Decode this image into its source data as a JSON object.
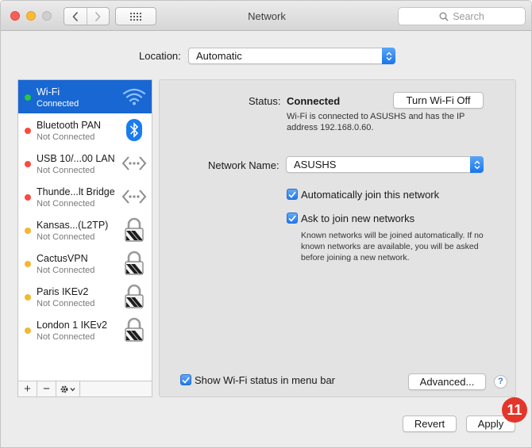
{
  "window": {
    "title": "Network"
  },
  "search": {
    "placeholder": "Search"
  },
  "location": {
    "label": "Location:",
    "value": "Automatic"
  },
  "services": [
    {
      "name": "Wi-Fi",
      "status": "Connected",
      "dot": "green",
      "icon": "wifi-icon",
      "selected": true
    },
    {
      "name": "Bluetooth PAN",
      "status": "Not Connected",
      "dot": "red",
      "icon": "bluetooth-icon"
    },
    {
      "name": "USB 10/...00 LAN",
      "status": "Not Connected",
      "dot": "red",
      "icon": "ethernet-icon"
    },
    {
      "name": "Thunde...lt Bridge",
      "status": "Not Connected",
      "dot": "red",
      "icon": "ethernet-icon"
    },
    {
      "name": "Kansas...(L2TP)",
      "status": "Not Connected",
      "dot": "yellow",
      "icon": "lock-icon"
    },
    {
      "name": "CactusVPN",
      "status": "Not Connected",
      "dot": "yellow",
      "icon": "lock-icon"
    },
    {
      "name": "Paris IKEv2",
      "status": "Not Connected",
      "dot": "yellow",
      "icon": "lock-icon"
    },
    {
      "name": "London 1 IKEv2",
      "status": "Not Connected",
      "dot": "yellow",
      "icon": "lock-icon"
    }
  ],
  "sidebar_footer": {
    "add": "+",
    "remove": "−"
  },
  "detail": {
    "status_label": "Status:",
    "status_value": "Connected",
    "turn_off_button": "Turn Wi-Fi Off",
    "status_description": "Wi-Fi is connected to ASUSHS and has the IP address 192.168.0.60.",
    "network_name_label": "Network Name:",
    "network_name_value": "ASUSHS",
    "auto_join_label": "Automatically join this network",
    "ask_join_label": "Ask to join new networks",
    "ask_join_description": "Known networks will be joined automatically. If no known networks are available, you will be asked before joining a new network.",
    "show_status_label": "Show Wi-Fi status in menu bar",
    "advanced_button": "Advanced...",
    "help_button": "?"
  },
  "footer": {
    "revert_button": "Revert",
    "apply_button": "Apply",
    "badge": "11"
  },
  "colors": {
    "selection": "#1967d2",
    "accent": "#2279ea",
    "badge": "#e4352b"
  }
}
